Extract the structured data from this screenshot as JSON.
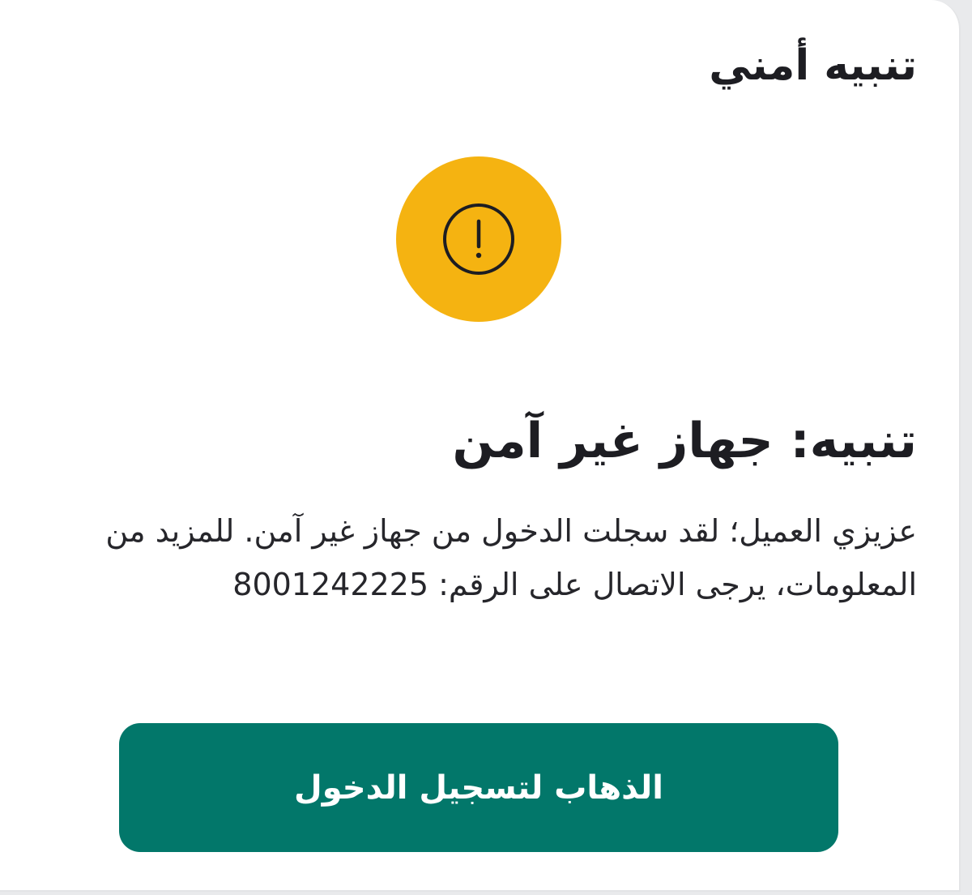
{
  "dialog": {
    "title": "تنبيه أمني",
    "icon": "alert-circle-icon",
    "icon_bg_color": "#f5b311",
    "heading": "تنبيه: جهاز غير آمن",
    "message": "عزيزي العميل؛ لقد سجلت الدخول من جهاز غير آمن. للمزيد من المعلومات، يرجى الاتصال على الرقم: 8001242225",
    "button_label": "الذهاب لتسجيل الدخول",
    "button_color": "#02776a"
  }
}
